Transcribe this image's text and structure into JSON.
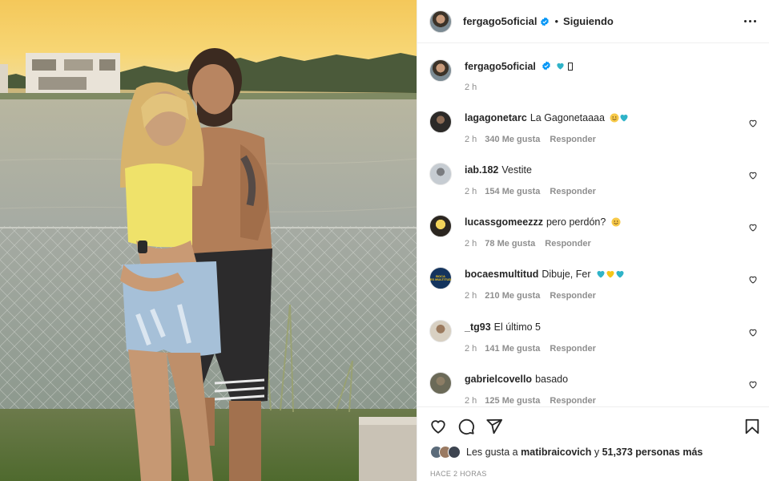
{
  "post": {
    "username": "fergago5oficial",
    "separator": "•",
    "follow_status": "Siguiendo",
    "caption_time": "2 h",
    "caption_emojis": [
      "blue-heart",
      "unsupported-glyph"
    ]
  },
  "comments": [
    {
      "username": "lagagonetarc",
      "text": "La Gagonetaaaa",
      "emojis": [
        "smiling-face",
        "blue-heart"
      ],
      "time": "2 h",
      "likes": "340 Me gusta",
      "reply": "Responder"
    },
    {
      "username": "iab.182",
      "text": "Vestite",
      "emojis": [],
      "time": "2 h",
      "likes": "154 Me gusta",
      "reply": "Responder"
    },
    {
      "username": "lucassgomeezzz",
      "text": "pero perdón?",
      "emojis": [
        "smiling-face"
      ],
      "time": "2 h",
      "likes": "78 Me gusta",
      "reply": "Responder"
    },
    {
      "username": "bocaesmultitud",
      "text": "Dibuje, Fer",
      "emojis": [
        "blue-heart",
        "yellow-heart",
        "blue-heart"
      ],
      "time": "2 h",
      "likes": "210 Me gusta",
      "reply": "Responder"
    },
    {
      "username": "_tg93",
      "text": "El último 5",
      "emojis": [],
      "time": "2 h",
      "likes": "141 Me gusta",
      "reply": "Responder"
    },
    {
      "username": "gabrielcovello",
      "text": "basado",
      "emojis": [],
      "time": "2 h",
      "likes": "125 Me gusta",
      "reply": "Responder"
    }
  ],
  "avatar_badge_text": "BOCA\nES MULTITUD",
  "likes": {
    "prefix": "Les gusta a",
    "user": "matibraicovich",
    "connector": "y",
    "others": "51,373 personas más"
  },
  "timestamp": "HACE 2 HORAS",
  "colors": {
    "verified": "#0095f6",
    "blue_heart": "#2fb3c8",
    "yellow_heart": "#f5c518",
    "text": "#262626",
    "secondary": "#8e8e8e",
    "divider": "#efefef"
  }
}
